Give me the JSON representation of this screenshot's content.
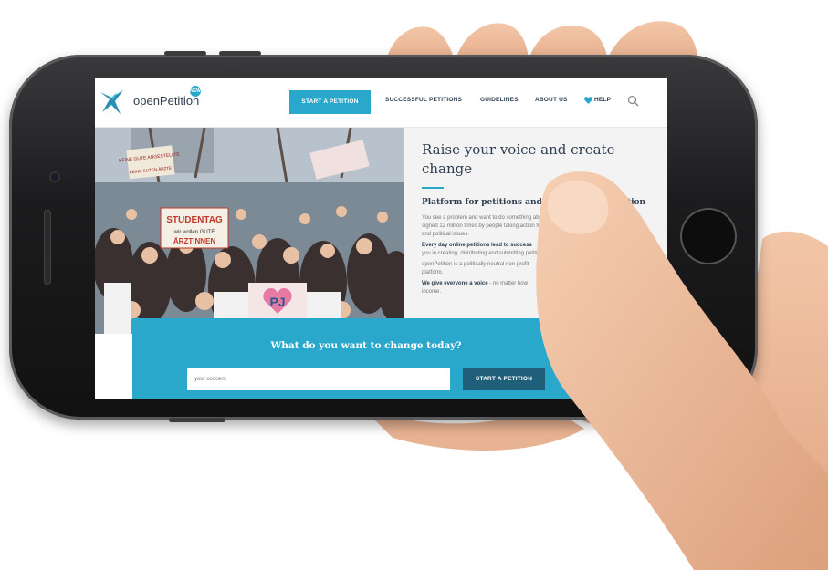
{
  "site": {
    "logo_text": "openPetition",
    "badge": "NEW"
  },
  "nav": {
    "start_label": "START A PETITION",
    "links": [
      "SUCCESSFUL PETITIONS",
      "GUIDELINES",
      "ABOUT US",
      "HELP"
    ]
  },
  "hero": {
    "title": "Raise your voice and create change",
    "subtitle": "Platform for petitions and political participation",
    "p1": "You see a problem and want to do something about it?",
    "p1b": "signed 12 million times by people taking action for social",
    "p1c": "and political issues.",
    "p2_bold": "Every day online petitions lead to success",
    "p2": "you in creating, distributing and submitting petitions.",
    "p3": "openPetition is a politically neutral non-profit",
    "p3b": "platform.",
    "p4_bold": "We give everyone a voice",
    "p4": " - no matter how",
    "p4b": "income."
  },
  "photo": {
    "sign_1": "STUDENTAG",
    "sign_2": "wir wollen GUTE",
    "sign_3": "ÄRZTINNEN",
    "sign_4": "PJ",
    "sign_5": "KEINE GUTE ANGESTELLTE",
    "sign_6": "KEINE GUTEN ÄRZTE"
  },
  "cta": {
    "title": "What do you want to change today?",
    "input_placeholder": "your concern",
    "button_label": "START A PETITION"
  },
  "colors": {
    "accent": "#29a8cb",
    "dark_button": "#1f5f7a",
    "text_dark": "#2d3e50"
  },
  "icons": [
    "logo-mark-icon",
    "heart-icon",
    "search-icon"
  ]
}
